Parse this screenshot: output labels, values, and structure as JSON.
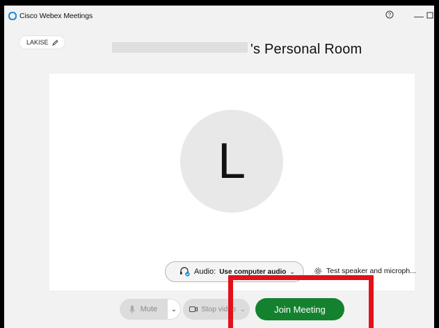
{
  "titlebar": {
    "app_title": "Cisco Webex Meetings",
    "help_icon": "question-circle-icon",
    "minimize_icon": "minimize-icon",
    "maximize_icon": "maximize-icon"
  },
  "header": {
    "name_tag": "LAKISE",
    "room_title": "'s Personal Room"
  },
  "preview": {
    "avatar_initial": "L",
    "audio_label": "Audio:",
    "audio_value": "Use computer audio",
    "test_speaker": "Test speaker and microph..."
  },
  "controls": {
    "mute_label": "Mute",
    "video_label": "Stop video",
    "join_label": "Join Meeting"
  },
  "colors": {
    "join_green": "#14812e",
    "highlight_red": "#e3101b",
    "window_bg": "#f2f2f2"
  }
}
